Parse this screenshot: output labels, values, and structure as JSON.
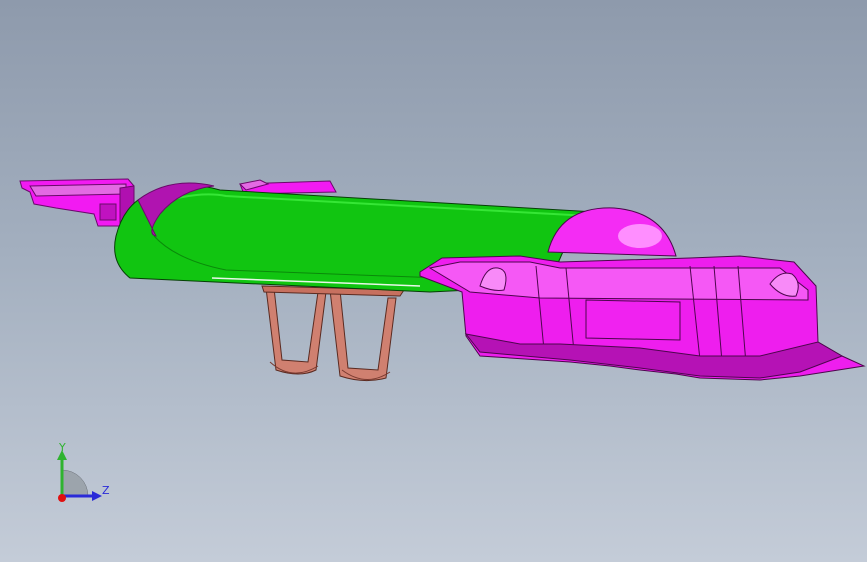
{
  "viewport": {
    "background_top": "#8e9aac",
    "background_bottom": "#c4ccd8"
  },
  "model": {
    "parts": [
      {
        "name": "housing-shell",
        "color": "#f21af2"
      },
      {
        "name": "tube-body",
        "color": "#0fd10f"
      },
      {
        "name": "spring-clip",
        "color": "#d08070"
      }
    ]
  },
  "triad": {
    "y_label": "Y",
    "z_label": "Z",
    "y_color": "#2fb32f",
    "z_color": "#2a2ad8",
    "origin_color": "#e01010",
    "icon": "view-orientation-triad"
  }
}
